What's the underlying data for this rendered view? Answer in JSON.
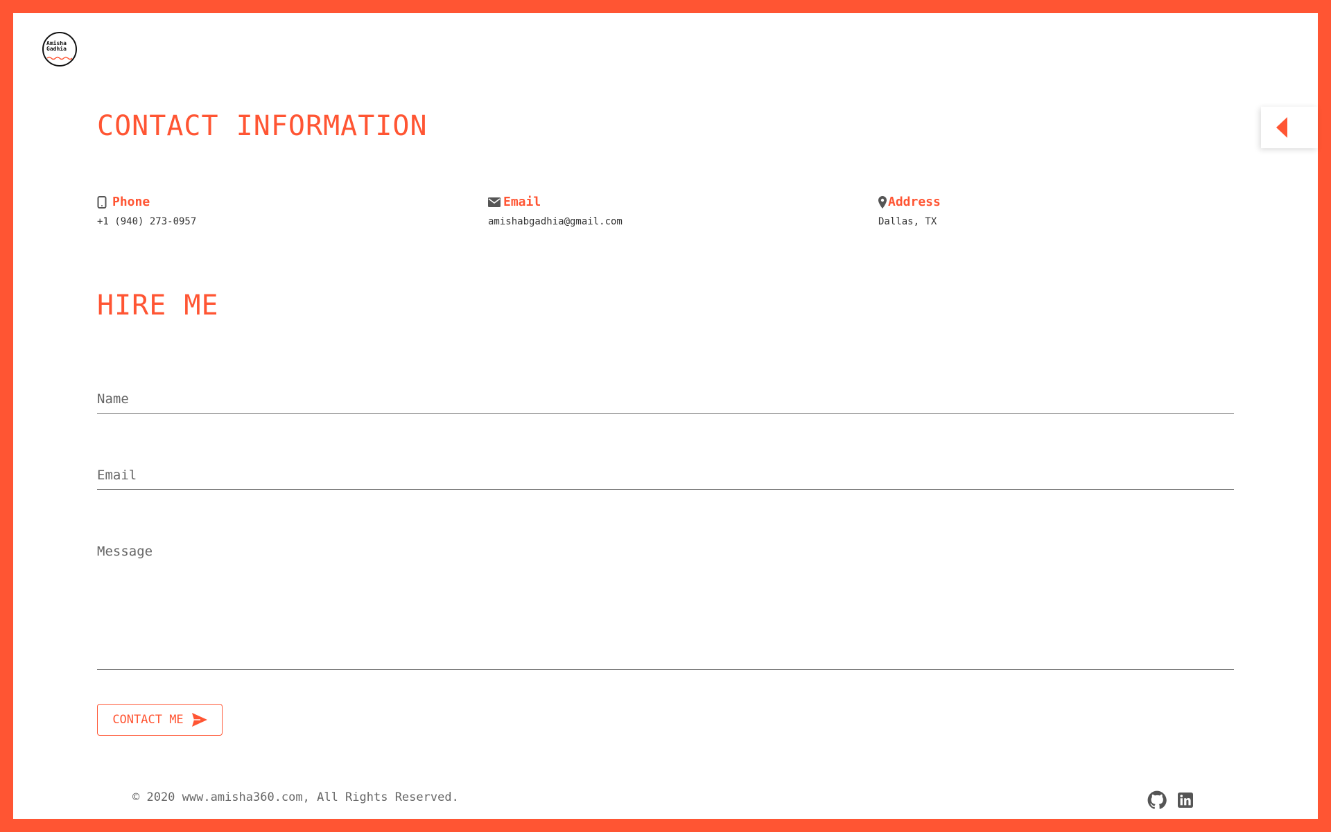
{
  "brand": {
    "logo_line1": "Amisha",
    "logo_line2": "Gadhia",
    "accent_color": "#ff5533"
  },
  "side_tab": {
    "icon": "caret-left-icon"
  },
  "contact_info": {
    "heading": "CONTACT INFORMATION",
    "phone": {
      "icon": "mobile-phone-icon",
      "label": "Phone",
      "value": "+1 (940) 273-0957"
    },
    "email": {
      "icon": "envelope-icon",
      "label": "Email",
      "value": "amishabgadhia@gmail.com"
    },
    "address": {
      "icon": "map-pin-icon",
      "label": "Address",
      "value": "Dallas, TX"
    }
  },
  "hire_me": {
    "heading": "HIRE ME",
    "name_placeholder": "Name",
    "email_placeholder": "Email",
    "message_placeholder": "Message",
    "button_label": "CONTACT ME",
    "button_icon": "send-icon"
  },
  "footer": {
    "copyright": "© 2020 www.amisha360.com, All Rights Reserved.",
    "social": [
      "github-icon",
      "linkedin-icon"
    ]
  }
}
